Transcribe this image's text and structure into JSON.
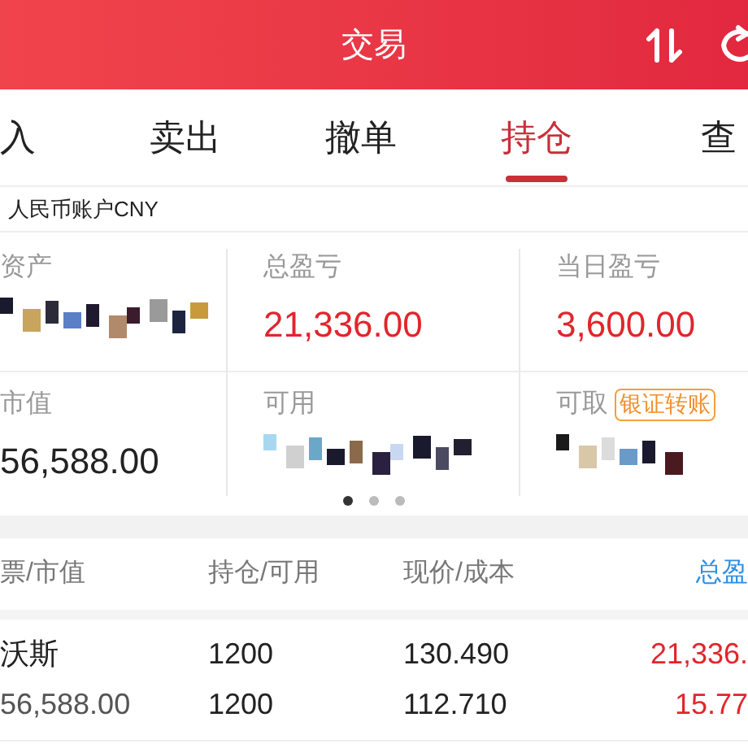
{
  "header": {
    "title": "交易"
  },
  "tabs": [
    {
      "label": "入",
      "selected": false
    },
    {
      "label": "卖出",
      "selected": false
    },
    {
      "label": "撤单",
      "selected": false
    },
    {
      "label": "持仓",
      "selected": true
    },
    {
      "label": "查",
      "selected": false
    }
  ],
  "account": {
    "label": "人民币账户CNY"
  },
  "summary": [
    {
      "label": "资产",
      "kind": "hidden"
    },
    {
      "label": "总盈亏",
      "kind": "gain",
      "value": "21,336.00"
    },
    {
      "label": "当日盈亏",
      "kind": "gain",
      "value": "3,600.00"
    },
    {
      "label": "市值",
      "kind": "plain",
      "value": "56,588.00"
    },
    {
      "label": "可用",
      "kind": "hidden"
    },
    {
      "label": "可取",
      "kind": "hidden",
      "action": "银证转账"
    }
  ],
  "pager": [
    {
      "selected": true
    },
    {
      "selected": false
    },
    {
      "selected": false
    }
  ],
  "table": {
    "columns": [
      {
        "label": "票/市值",
        "selected": false
      },
      {
        "label": "持仓/可用",
        "selected": false
      },
      {
        "label": "现价/成本",
        "selected": false
      },
      {
        "label": "总盈",
        "selected": true
      }
    ],
    "rows": [
      {
        "cells": [
          [
            "沃斯",
            "56,588.00"
          ],
          [
            "1200",
            "1200"
          ],
          [
            "130.490",
            "112.710"
          ],
          [
            "21,336.",
            "15.77"
          ]
        ]
      }
    ]
  }
}
